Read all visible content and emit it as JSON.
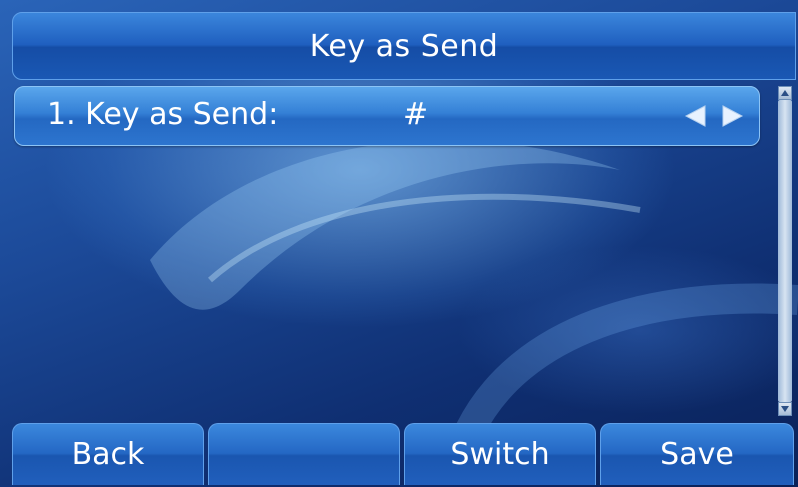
{
  "header": {
    "title": "Key as Send"
  },
  "setting": {
    "label": "1. Key as Send:",
    "value": "#"
  },
  "softkeys": {
    "back": "Back",
    "blank": "",
    "switch": "Switch",
    "save": "Save"
  },
  "icons": {
    "left": "arrow-left-icon",
    "right": "arrow-right-icon"
  },
  "colors": {
    "accent": "#2467c4",
    "background": "#1c4a99",
    "text": "#ffffff"
  }
}
